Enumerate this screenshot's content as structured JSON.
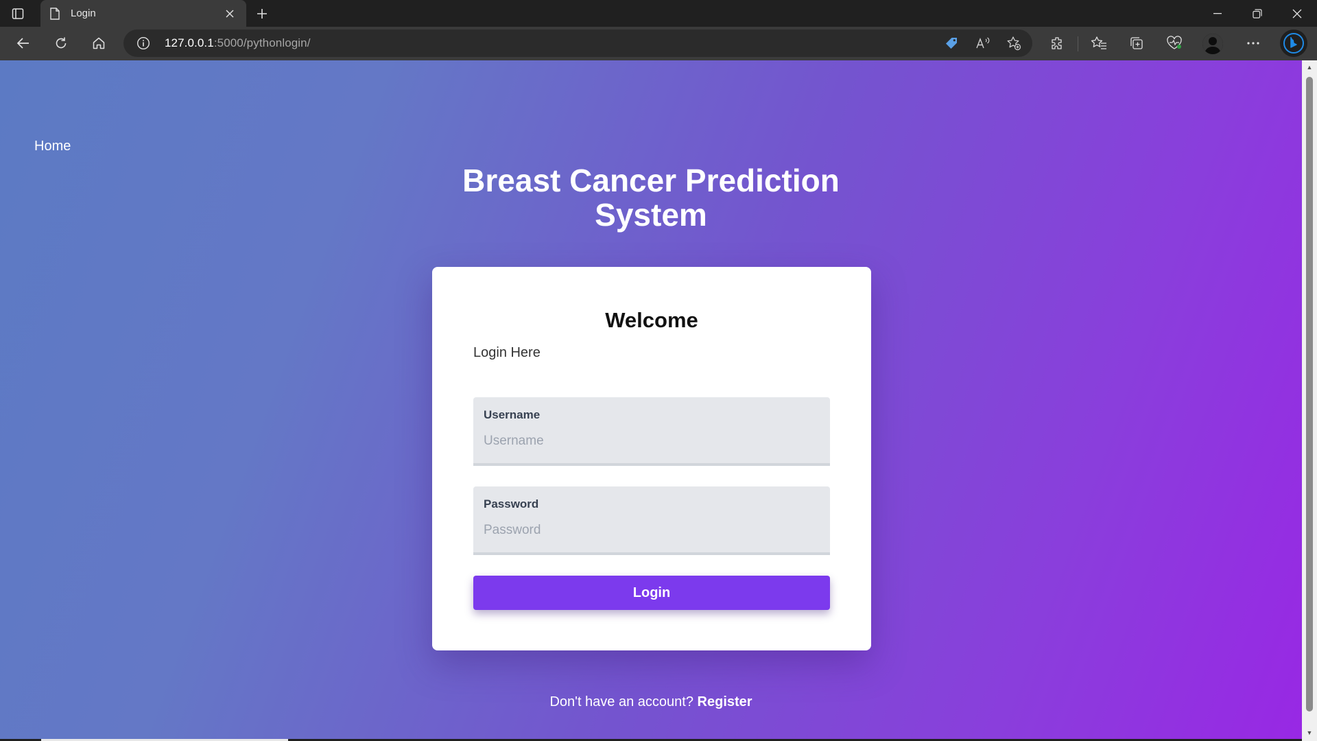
{
  "browser": {
    "tab_title": "Login",
    "url_host": "127.0.0.1",
    "url_path": ":5000/pythonlogin/"
  },
  "page": {
    "nav_home": "Home",
    "title_line1": "Breast Cancer Prediction",
    "title_line2": "System",
    "card": {
      "heading": "Welcome",
      "subtitle": "Login Here",
      "username_label": "Username",
      "username_placeholder": "Username",
      "password_label": "Password",
      "password_placeholder": "Password",
      "login_button": "Login"
    },
    "register_prompt": "Don't have an account?",
    "register_link": "Register"
  },
  "colors": {
    "accent": "#7c3aed",
    "gradient_start": "#5c7ac4",
    "gradient_end": "#9828e4"
  }
}
